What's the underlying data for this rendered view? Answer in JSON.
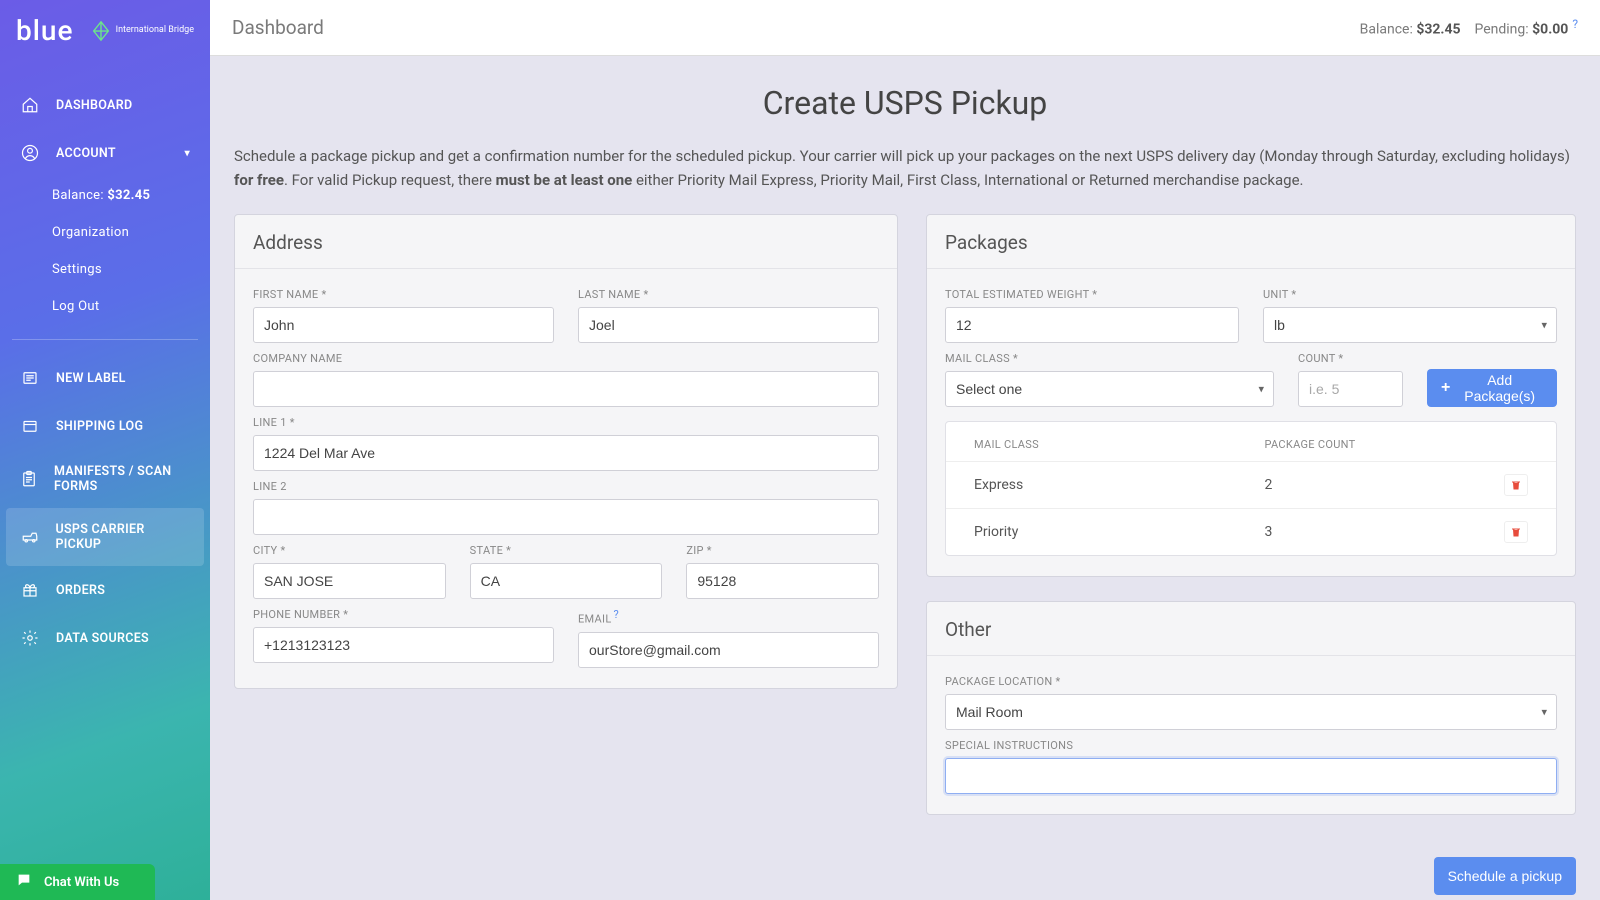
{
  "brand": {
    "name": "blue",
    "sub": "International Bridge"
  },
  "topbar": {
    "title": "Dashboard",
    "balance_label": "Balance:",
    "balance_value": "$32.45",
    "pending_label": "Pending:",
    "pending_value": "$0.00"
  },
  "sidebar": {
    "items": [
      {
        "label": "DASHBOARD"
      },
      {
        "label": "ACCOUNT"
      },
      {
        "label": "NEW LABEL"
      },
      {
        "label": "SHIPPING LOG"
      },
      {
        "label": "MANIFESTS / SCAN FORMS"
      },
      {
        "label": "USPS CARRIER PICKUP"
      },
      {
        "label": "ORDERS"
      },
      {
        "label": "DATA SOURCES"
      }
    ],
    "account_sub": {
      "balance_label": "Balance:",
      "balance_value": "$32.45",
      "org": "Organization",
      "settings": "Settings",
      "logout": "Log Out"
    }
  },
  "chat": {
    "label": "Chat With Us"
  },
  "page": {
    "title": "Create USPS Pickup",
    "intro1": "Schedule a package pickup and get a confirmation number for the scheduled pickup. Your carrier will pick up your packages on the next USPS delivery day (Monday through Saturday, excluding holidays) ",
    "intro1_bold": "for free",
    "intro1_tail": ". For valid Pickup request, there ",
    "intro2_bold": "must be at least one",
    "intro2_tail": " either Priority Mail Express, Priority Mail, First Class, International or Returned merchandise package."
  },
  "address": {
    "card_title": "Address",
    "first_name_label": "FIRST NAME *",
    "first_name": "John",
    "last_name_label": "LAST NAME *",
    "last_name": "Joel",
    "company_label": "COMPANY NAME",
    "company": "",
    "line1_label": "LINE 1 *",
    "line1": "1224 Del Mar Ave",
    "line2_label": "LINE 2",
    "line2": "",
    "city_label": "CITY *",
    "city": "SAN JOSE",
    "state_label": "STATE *",
    "state": "CA",
    "zip_label": "ZIP *",
    "zip": "95128",
    "phone_label": "PHONE NUMBER *",
    "phone": "+1213123123",
    "email_label": "EMAIL",
    "email": "ourStore@gmail.com"
  },
  "packages": {
    "card_title": "Packages",
    "weight_label": "TOTAL ESTIMATED WEIGHT *",
    "weight": "12",
    "unit_label": "UNIT *",
    "unit": "lb",
    "mail_class_label": "MAIL CLASS *",
    "mail_class": "Select one",
    "count_label": "COUNT *",
    "count_placeholder": "i.e. 5",
    "add_btn": "Add Package(s)",
    "th_class": "MAIL CLASS",
    "th_count": "PACKAGE COUNT",
    "rows": [
      {
        "class": "Express",
        "count": "2"
      },
      {
        "class": "Priority",
        "count": "3"
      }
    ]
  },
  "other": {
    "card_title": "Other",
    "location_label": "PACKAGE LOCATION *",
    "location": "Mail Room",
    "instructions_label": "SPECIAL INSTRUCTIONS",
    "instructions": ""
  },
  "schedule_btn": "Schedule a pickup"
}
